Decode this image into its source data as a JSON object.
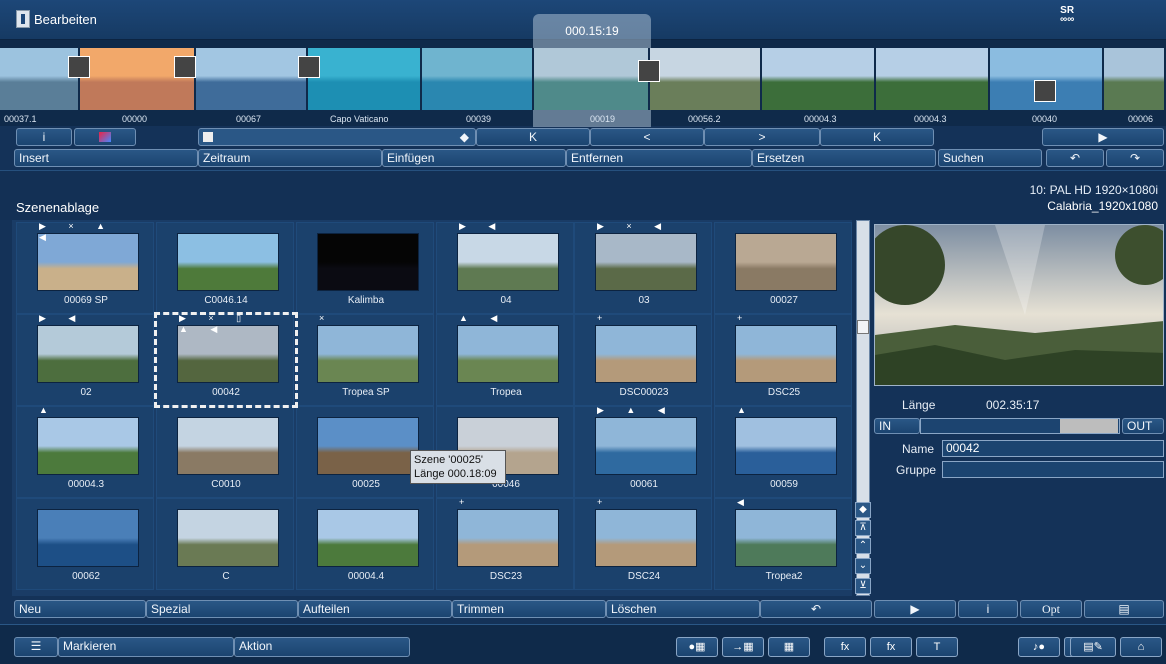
{
  "window": {
    "title": "Bearbeiten",
    "logo": "SR"
  },
  "filmstrip": {
    "current_time": "000.15:19",
    "clips": [
      {
        "label": "00037.1",
        "color": "#5a7e98",
        "sky": "#9cc3df"
      },
      {
        "label": "00000",
        "color": "#c0795a",
        "sky": "#f2a86a"
      },
      {
        "label": "00067",
        "color": "#3f6c9a",
        "sky": "#a2c6e2"
      },
      {
        "label": "Capo Vaticano",
        "color": "#1d8fb3",
        "sky": "#39b2d0"
      },
      {
        "label": "00039",
        "color": "#2a87b0",
        "sky": "#6fb4cf"
      },
      {
        "label": "00019",
        "color": "#4f8a8a",
        "sky": "#b0c8d8"
      },
      {
        "label": "00056.2",
        "color": "#6a7e5a",
        "sky": "#c7d6e2"
      },
      {
        "label": "00004.3",
        "color": "#3c6e3a",
        "sky": "#b6cfe6"
      },
      {
        "label": "00004.3",
        "color": "#3c6e3a",
        "sky": "#b6cfe6"
      },
      {
        "label": "00040",
        "color": "#3c7eb3",
        "sky": "#8bbce0"
      },
      {
        "label": "00006",
        "color": "#5a7a52",
        "sky": "#a9c4da"
      }
    ]
  },
  "row1": {
    "info_icon": "i",
    "effect_icon": "effect-icon",
    "nav_marker": "◆",
    "first": "K",
    "prev": "<",
    "next": ">",
    "last": "K",
    "play": "▶"
  },
  "row2": {
    "insert": "Insert",
    "zeitraum": "Zeitraum",
    "einfuegen": "Einfügen",
    "entfernen": "Entfernen",
    "ersetzen": "Ersetzen",
    "suchen": "Suchen",
    "undo": "↶",
    "redo": "↷"
  },
  "scenes": {
    "title": "Szenenablage",
    "format_line1": "10: PAL HD 1920×1080i",
    "format_line2": "Calabria_1920x1080",
    "items": [
      {
        "label": "00069 SP",
        "sky": "#7fa8d6",
        "ground": "#c9b08a",
        "markers": "▶ × ▲ ◀"
      },
      {
        "label": "C0046.14",
        "sky": "#8cbfe3",
        "ground": "#4e7a3a",
        "markers": ""
      },
      {
        "label": "Kalimba",
        "sky": "#050505",
        "ground": "#0b0b12",
        "markers": ""
      },
      {
        "label": "04",
        "sky": "#c8d8e6",
        "ground": "#5f7a52",
        "markers": "▶ ◀"
      },
      {
        "label": "03",
        "sky": "#a8b8c8",
        "ground": "#5b6a48",
        "markers": "▶ × ◀"
      },
      {
        "label": "00027",
        "sky": "#b9a893",
        "ground": "#8a7a64",
        "markers": ""
      },
      {
        "label": "02",
        "sky": "#b4cad9",
        "ground": "#4d6e3e",
        "markers": "▶ ◀"
      },
      {
        "label": "00042",
        "sky": "#aeb8c4",
        "ground": "#54663f",
        "markers": "▶ × ▯ ▲ ◀"
      },
      {
        "label": "Tropea SP",
        "sky": "#8fb6d8",
        "ground": "#6a8652",
        "markers": "×"
      },
      {
        "label": "Tropea",
        "sky": "#8fb6d8",
        "ground": "#6a8652",
        "markers": "▲ ◀"
      },
      {
        "label": "DSC00023",
        "sky": "#8fb6d8",
        "ground": "#b49a7a",
        "markers": "+"
      },
      {
        "label": "DSC25",
        "sky": "#8fb6d8",
        "ground": "#b49a7a",
        "markers": "+"
      },
      {
        "label": "00004.3",
        "sky": "#a9c8e6",
        "ground": "#4c7a3c",
        "markers": "▲"
      },
      {
        "label": "C0010",
        "sky": "#c4d4e2",
        "ground": "#8a7a64",
        "markers": ""
      },
      {
        "label": "00025",
        "sky": "#5b8fc7",
        "ground": "#7a6248",
        "markers": ""
      },
      {
        "label": "00046",
        "sky": "#c9d0d8",
        "ground": "#b4a48e",
        "markers": ""
      },
      {
        "label": "00061",
        "sky": "#8fb6d8",
        "ground": "#2f6aa0",
        "markers": "▶ ▲ ◀"
      },
      {
        "label": "00059",
        "sky": "#a0c0e0",
        "ground": "#2a5f9a",
        "markers": "▲"
      },
      {
        "label": "00062",
        "sky": "#4a7fb8",
        "ground": "#1d4f86",
        "markers": ""
      },
      {
        "label": "C",
        "sky": "#c4d4e2",
        "ground": "#6a7a54",
        "markers": ""
      },
      {
        "label": "00004.4",
        "sky": "#a9c8e6",
        "ground": "#4c7a3c",
        "markers": ""
      },
      {
        "label": "DSC23",
        "sky": "#8fb6d8",
        "ground": "#b49a7a",
        "markers": "+"
      },
      {
        "label": "DSC24",
        "sky": "#8fb6d8",
        "ground": "#b49a7a",
        "markers": "+"
      },
      {
        "label": "Tropea2",
        "sky": "#8fb6d8",
        "ground": "#4e7a5a",
        "markers": "◀"
      }
    ],
    "tooltip_line1": "Szene '00025'",
    "tooltip_line2": "Länge 000.18:09"
  },
  "preview": {
    "laenge_label": "Länge",
    "laenge_value": "002.35:17",
    "in_label": "IN",
    "out_label": "OUT",
    "name_label": "Name",
    "name_value": "00042",
    "gruppe_label": "Gruppe",
    "gruppe_value": ""
  },
  "row3": {
    "neu": "Neu",
    "spezial": "Spezial",
    "aufteilen": "Aufteilen",
    "trimmen": "Trimmen",
    "loeschen": "Löschen",
    "restore": "↶",
    "play": "▶",
    "info": "i",
    "opt": "Opt",
    "print": "▤"
  },
  "bottombar": {
    "markieren": "Markieren",
    "aktion": "Aktion",
    "tools": [
      "●▦",
      "→▦",
      "▦",
      "fx",
      "fx",
      "T",
      "♪●",
      "♪▤",
      "▤✎",
      "⌂"
    ]
  }
}
